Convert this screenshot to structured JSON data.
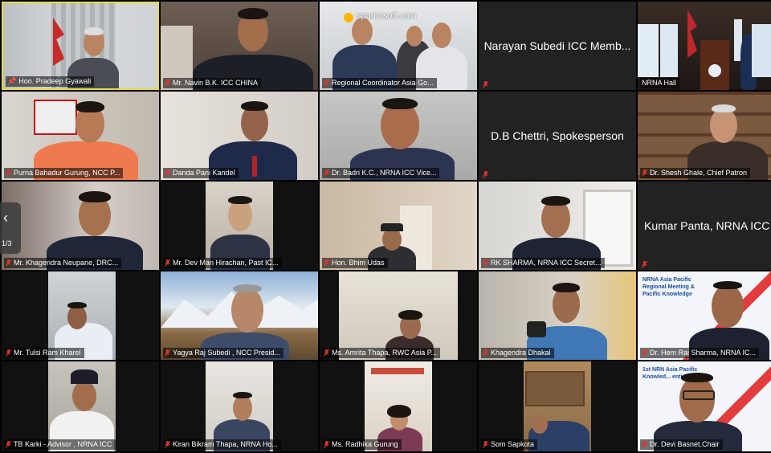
{
  "meeting": {
    "pager": {
      "arrow": "‹",
      "page_indicator": "1/3"
    }
  },
  "tiles": [
    {
      "name": "Hon. Pradeep Gyawali",
      "pinned": true
    },
    {
      "name": "Mr. Navin B.K. ICC CHINA"
    },
    {
      "name": "Regional Coordinator Asia Go...",
      "watermark": "sparkosoft.com"
    },
    {
      "name": "",
      "center_text": "Narayan Subedi ICC Memb..."
    },
    {
      "name": "NRNA Hall"
    },
    {
      "name": "Purna Bahadur Gurung, NCC P..."
    },
    {
      "name": "Danda Pani Kandel"
    },
    {
      "name": "Dr. Badri K.C., NRNA ICC Vice..."
    },
    {
      "name": "",
      "center_text": "D.B Chettri, Spokesperson"
    },
    {
      "name": "Dr. Shesh Ghale, Chief Patron"
    },
    {
      "name": "Mr. Khagendra Neupane, DRC..."
    },
    {
      "name": "Mr. Dev Man Hirachan, Past IC..."
    },
    {
      "name": "Hon. Bhim Udas"
    },
    {
      "name": "RK SHARMA, NRNA ICC Secret..."
    },
    {
      "name": "",
      "center_text": "Kumar Panta, NRNA ICC P..."
    },
    {
      "name": "Mr. Tulsi Ram Kharel"
    },
    {
      "name": "Yagya Raj Subedi , NCC Presid..."
    },
    {
      "name": "Ms. Amrita Thapa, RWC Asia P..."
    },
    {
      "name": "Khagendra Dhakal"
    },
    {
      "name": "Dr. Hem Raj Sharma, NRNA IC...",
      "banner_text": "NRNA Asia Pacific Regional Meeting & Pacific Knowledge"
    },
    {
      "name": "TB Karki - Advisor , NRNA ICC"
    },
    {
      "name": "Kiran Bikram Thapa, NRNA Ho..."
    },
    {
      "name": "Ms. Radhika Gurung"
    },
    {
      "name": "Som Sapkota"
    },
    {
      "name": "Dr. Devi Basnet.Chair",
      "banner_text": "1st NRN Asia Pacific Knowled... ention"
    }
  ],
  "colors": {
    "active_border": "#e6dc46",
    "muted_mic": "#e0342b"
  }
}
